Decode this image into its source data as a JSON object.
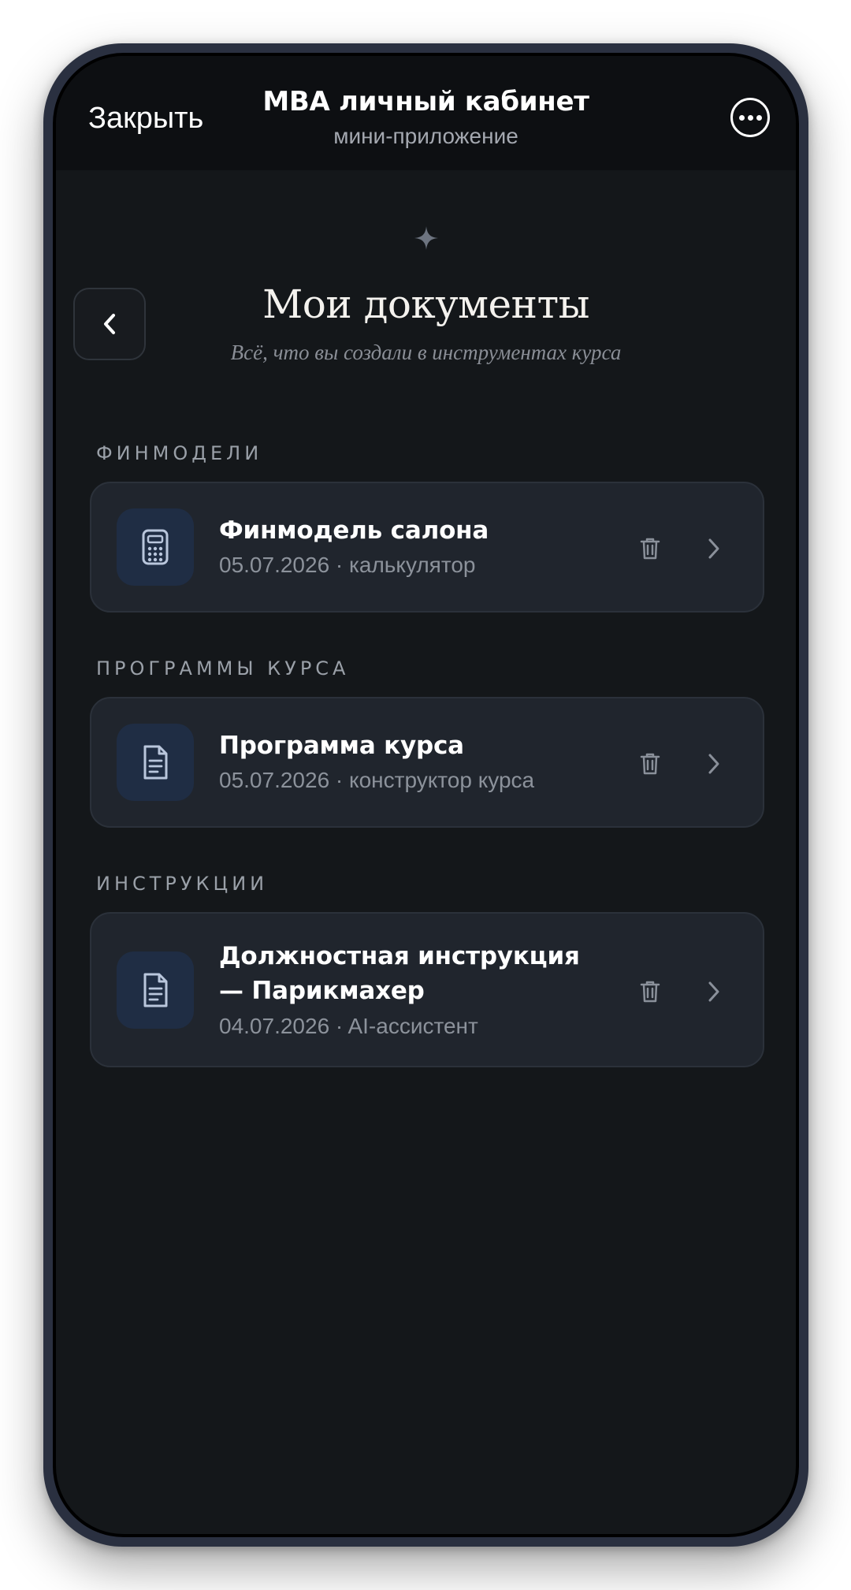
{
  "header": {
    "close_label": "Закрыть",
    "title": "MBA личный кабинет",
    "subtitle": "мини-приложение",
    "more_icon": "more-horizontal-circle-icon"
  },
  "page": {
    "title": "Мои документы",
    "subtitle": "Всё, что вы создали в инструментах курса",
    "decor_icon": "sparkle-icon",
    "back_icon": "chevron-left-icon"
  },
  "sections": [
    {
      "label": "ФИНМОДЕЛИ",
      "items": [
        {
          "title": "Финмодель салона",
          "meta": "05.07.2026 · калькулятор",
          "icon": "calculator-icon"
        }
      ]
    },
    {
      "label": "ПРОГРАММЫ КУРСА",
      "items": [
        {
          "title": "Программа курса",
          "meta": "05.07.2026 · конструктор курса",
          "icon": "document-icon"
        }
      ]
    },
    {
      "label": "ИНСТРУКЦИИ",
      "items": [
        {
          "title_line1": "Должностная инструкция",
          "title_line2": "— Парикмахер",
          "meta": "04.07.2026 · AI-ассистент",
          "icon": "document-icon"
        }
      ]
    }
  ],
  "colors": {
    "background": "#14171a",
    "topbar": "#0d0f12",
    "card": "#20252d",
    "icon_tile": "#1f2d44",
    "icon_stroke": "#b9c6dc"
  }
}
